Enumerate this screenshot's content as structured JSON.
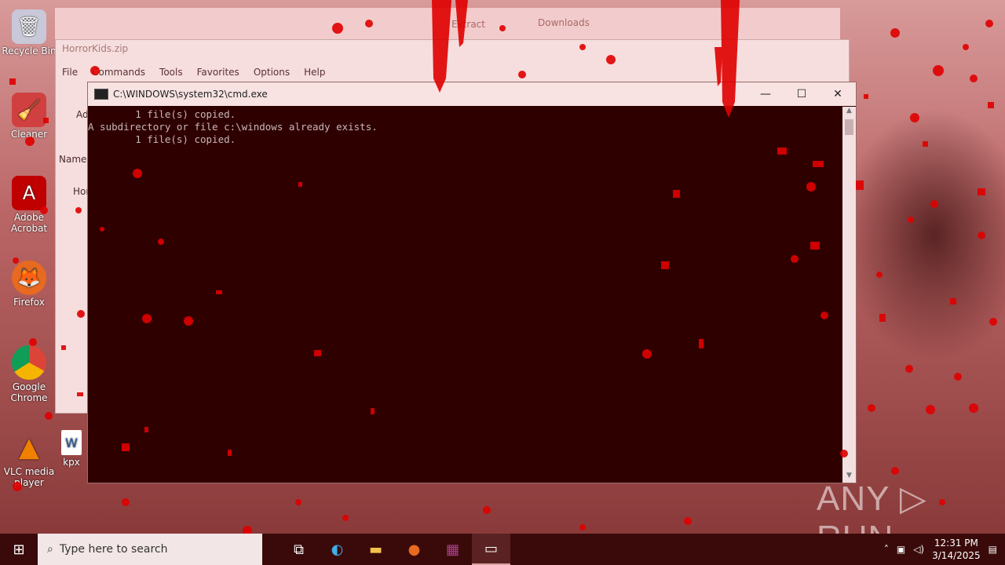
{
  "desktop": {
    "icons": [
      {
        "label": "Recycle Bin",
        "icon": "recycle-bin-icon"
      },
      {
        "label": "Cleaner",
        "icon": "ccleaner-icon"
      },
      {
        "label": "Adobe Acrobat",
        "icon": "acrobat-icon"
      },
      {
        "label": "Firefox",
        "icon": "firefox-icon"
      },
      {
        "label": "Google Chrome",
        "icon": "chrome-icon"
      },
      {
        "label": "VLC media player",
        "icon": "vlc-icon"
      },
      {
        "label": "kpx",
        "icon": "word-doc-icon"
      }
    ]
  },
  "downloads_strip": {
    "extract_label": "Extract",
    "downloads_label": "Downloads"
  },
  "bg_window": {
    "title": "HorrorKids.zip",
    "menu": [
      "File",
      "Commands",
      "Tools",
      "Favorites",
      "Options",
      "Help"
    ],
    "column_name": "Name",
    "row_text": "Hor",
    "side_label": "Ad"
  },
  "cmd": {
    "title": "C:\\WINDOWS\\system32\\cmd.exe",
    "lines": [
      "        1 file(s) copied.",
      "A subdirectory or file c:\\windows already exists.",
      "        1 file(s) copied."
    ],
    "minimize": "—",
    "maximize": "☐",
    "close": "✕"
  },
  "watermark": "ANY ▷ RUN",
  "taskbar": {
    "search_placeholder": "Type here to search",
    "time": "12:31 PM",
    "date": "3/14/2025"
  },
  "colors": {
    "accent_red": "#e00000",
    "console_bg": "#2f0000",
    "taskbar_bg": "#3a0a0a"
  }
}
